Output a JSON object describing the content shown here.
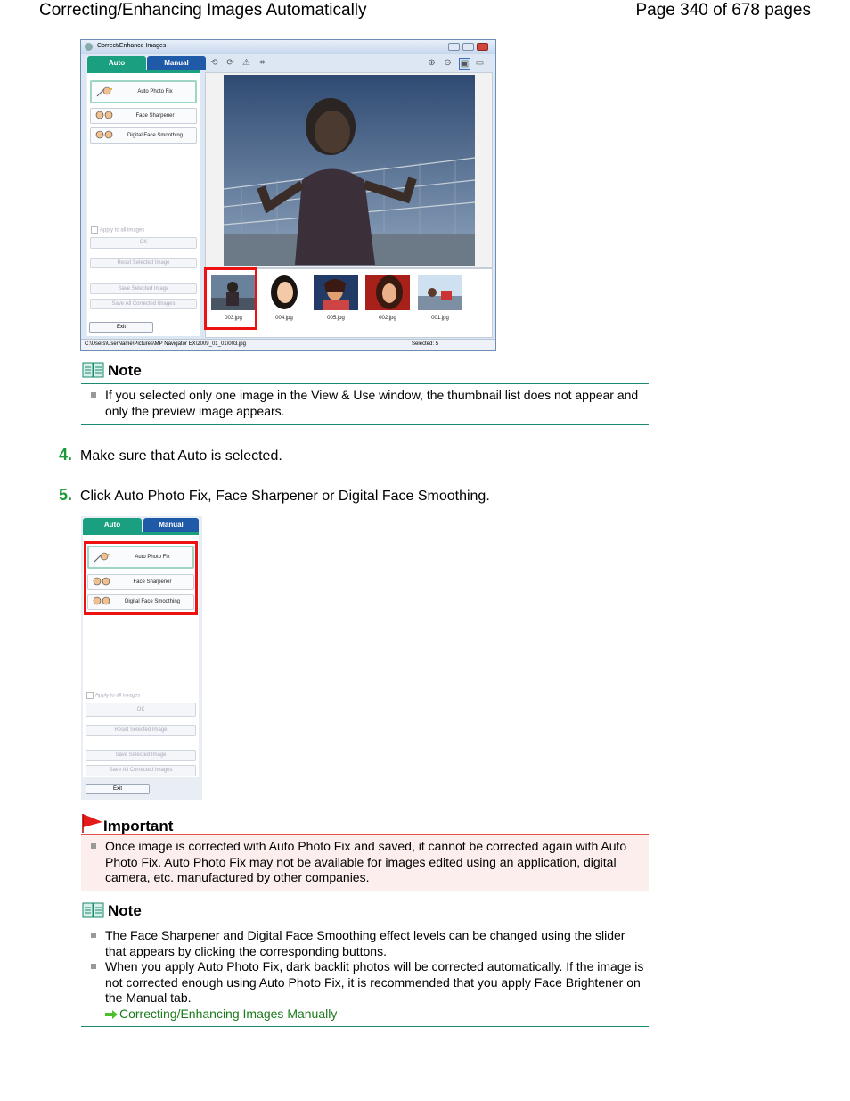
{
  "header": {
    "left": "Correcting/Enhancing Images Automatically",
    "right": "Page 340 of 678 pages"
  },
  "window": {
    "title": "Correct/Enhance Images",
    "tabs": {
      "auto": "Auto",
      "manual": "Manual"
    },
    "buttons": {
      "auto_photo_fix": "Auto Photo Fix",
      "face_sharpener": "Face Sharpener",
      "digital_face_smoothing": "Digital Face Smoothing",
      "apply_all": "Apply to all images",
      "ok": "OK",
      "reset": "Reset Selected Image",
      "save_selected": "Save Selected Image",
      "save_all": "Save All Corrected Images",
      "exit": "Exit"
    },
    "thumbnails": [
      "003.jpg",
      "004.jpg",
      "005.jpg",
      "002.jpg",
      "001.jpg"
    ],
    "status_path": "C:\\Users\\UserName\\Pictures\\MP Navigator EX\\2009_01_01\\003.jpg",
    "status_selected": "Selected: 5"
  },
  "note1": {
    "title": "Note",
    "items": [
      "If you selected only one image in the View & Use window, the thumbnail list does not appear and only the preview image appears."
    ]
  },
  "steps": [
    {
      "num": "4.",
      "text": "Make sure that Auto is selected."
    },
    {
      "num": "5.",
      "text": "Click Auto Photo Fix, Face Sharpener or Digital Face Smoothing."
    }
  ],
  "important": {
    "title": "Important",
    "items": [
      "Once image is corrected with Auto Photo Fix and saved, it cannot be corrected again with Auto Photo Fix. Auto Photo Fix may not be available for images edited using an application, digital camera, etc. manufactured by other companies."
    ]
  },
  "note2": {
    "title": "Note",
    "items": [
      "The Face Sharpener and Digital Face Smoothing effect levels can be changed using the slider that appears by clicking the corresponding buttons.",
      "When you apply Auto Photo Fix, dark backlit photos will be corrected automatically. If the image is not corrected enough using Auto Photo Fix, it is recommended that you apply Face Brightener on the Manual tab."
    ],
    "link": "Correcting/Enhancing Images Manually"
  }
}
